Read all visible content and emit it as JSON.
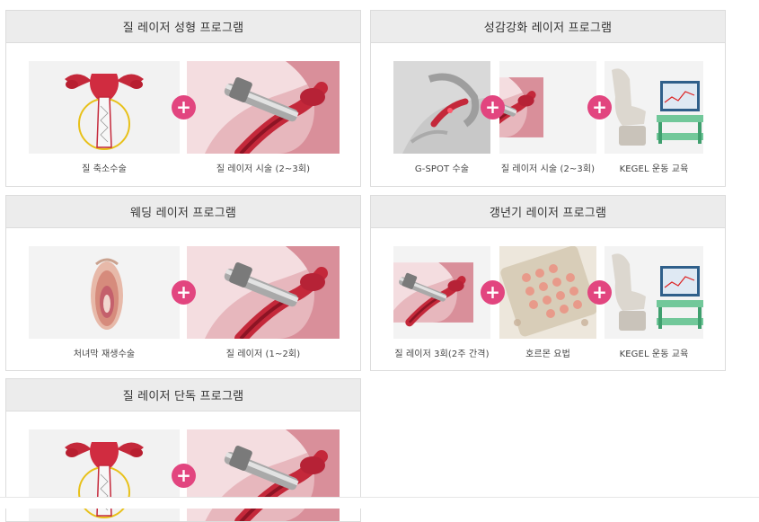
{
  "cards": [
    {
      "title": "질 레이저 성형 프로그램",
      "items": [
        {
          "caption": "질 축소수술",
          "image": "uterus-diagram-image"
        },
        {
          "caption": "질 레이저 시술 (2~3회)",
          "image": "laser-procedure-image"
        }
      ]
    },
    {
      "title": "성감강화 레이저 프로그램",
      "items": [
        {
          "caption": "G-SPOT 수술",
          "image": "gspot-anatomy-image"
        },
        {
          "caption": "질 레이저 시술 (2~3회)",
          "image": "laser-procedure-image"
        },
        {
          "caption": "KEGEL 운동 교육",
          "image": "kegel-chair-image"
        }
      ]
    },
    {
      "title": "웨딩 레이저 프로그램",
      "items": [
        {
          "caption": "처녀막 재생수술",
          "image": "hymen-image"
        },
        {
          "caption": "질 레이저 (1~2회)",
          "image": "laser-procedure-image"
        }
      ]
    },
    {
      "title": "갱년기 레이저 프로그램",
      "items": [
        {
          "caption": "질 레이저 3회(2주 간격)",
          "image": "laser-procedure-image"
        },
        {
          "caption": "호르몬 요법",
          "image": "hormone-pills-image"
        },
        {
          "caption": "KEGEL 운동 교육",
          "image": "kegel-chair-image"
        }
      ]
    },
    {
      "title": "질 레이저 단독 프로그램",
      "items": [
        {
          "caption": "",
          "image": "uterus-diagram-image"
        },
        {
          "caption": "",
          "image": "laser-procedure-image"
        }
      ]
    }
  ],
  "plus_symbol": "+",
  "colors": {
    "accent": "#e2457f",
    "header_bg": "#ececec",
    "border": "#dcdcdc",
    "anatomy_red": "#c4283a"
  }
}
